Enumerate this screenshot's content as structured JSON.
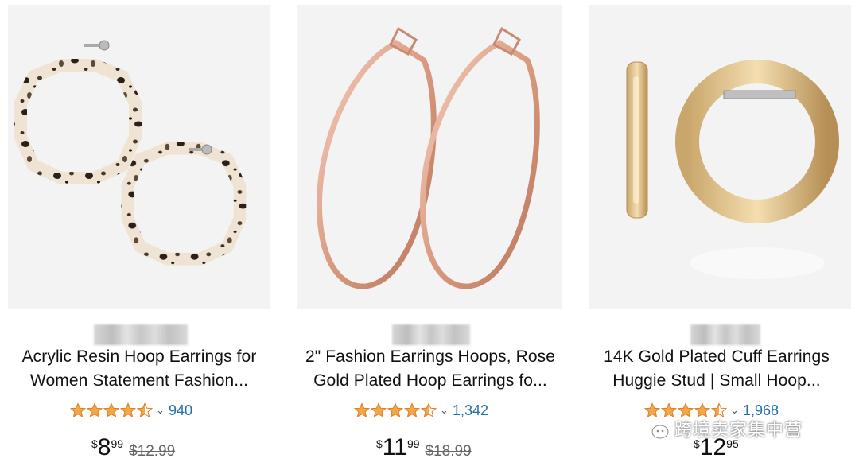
{
  "products": [
    {
      "title_line1": "Acrylic Resin Hoop Earrings for",
      "title_line2": "Women Statement Fashion...",
      "rating": 4.5,
      "review_count": "940",
      "price_currency": "$",
      "price_whole": "8",
      "price_fraction": "99",
      "list_price": "$12.99",
      "image_icon": "tortoiseshell-octagon-hoop-earrings"
    },
    {
      "title_line1": "2\" Fashion Earrings Hoops, Rose",
      "title_line2": "Gold Plated Hoop Earrings fo...",
      "rating": 4.5,
      "review_count": "1,342",
      "price_currency": "$",
      "price_whole": "11",
      "price_fraction": "99",
      "list_price": "$18.99",
      "image_icon": "rose-gold-hoop-earrings"
    },
    {
      "title_line1": "14K Gold Plated Cuff Earrings",
      "title_line2": "Huggie Stud | Small Hoop...",
      "rating": 4.5,
      "review_count": "1,968",
      "price_currency": "$",
      "price_whole": "12",
      "price_fraction": "95",
      "list_price": "",
      "image_icon": "gold-huggie-cuff-earrings"
    }
  ],
  "watermark": {
    "text": "跨境卖家集中营",
    "icon": "wechat-icon"
  },
  "colors": {
    "star": "#f3a847",
    "link": "#1f6fa8",
    "image_bg": "#f3f3f3"
  }
}
